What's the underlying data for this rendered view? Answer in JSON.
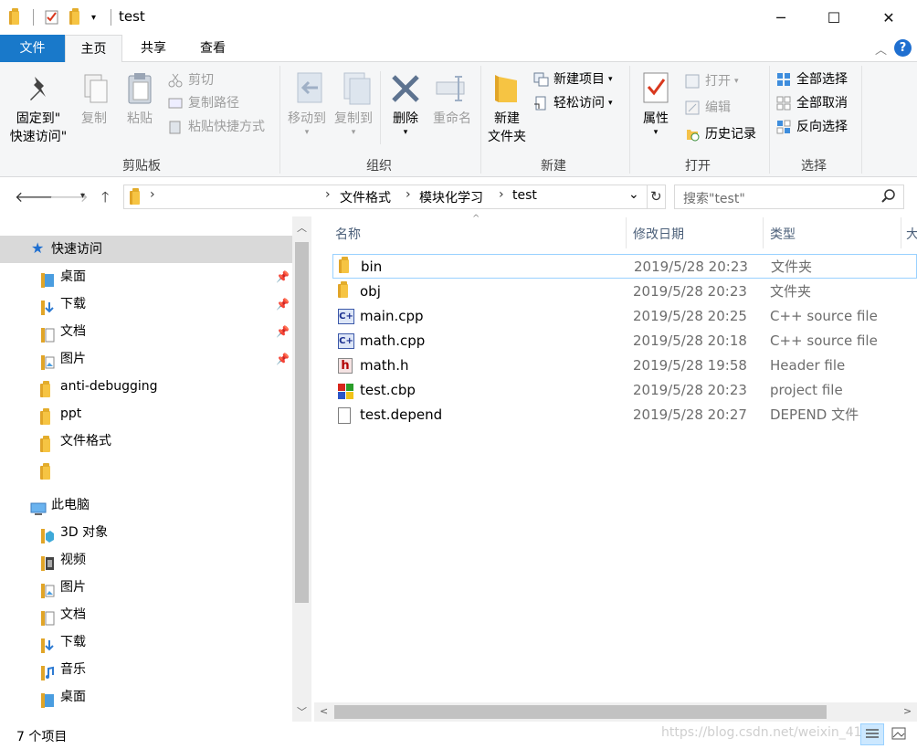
{
  "window": {
    "title": "test",
    "minimize": "─",
    "maximize": "☐",
    "close": "✕"
  },
  "ribbon_tabs": {
    "file": "文件",
    "home": "主页",
    "share": "共享",
    "view": "查看"
  },
  "ribbon": {
    "clipboard": {
      "label": "剪贴板",
      "pin_line1": "固定到\"",
      "pin_line2": "快速访问\"",
      "copy": "复制",
      "paste": "粘贴",
      "cut": "剪切",
      "copy_path": "复制路径",
      "paste_shortcut": "粘贴快捷方式"
    },
    "organize": {
      "label": "组织",
      "move_to": "移动到",
      "copy_to": "复制到",
      "delete": "删除",
      "rename": "重命名"
    },
    "new": {
      "label": "新建",
      "new_folder_line1": "新建",
      "new_folder_line2": "文件夹",
      "new_item": "新建项目",
      "easy_access": "轻松访问"
    },
    "open": {
      "label": "打开",
      "properties": "属性",
      "open": "打开",
      "edit": "编辑",
      "history": "历史记录"
    },
    "select": {
      "label": "选择",
      "select_all": "全部选择",
      "select_none": "全部取消",
      "invert": "反向选择"
    }
  },
  "address": {
    "breadcrumbs": [
      "文件格式",
      "模块化学习",
      "test"
    ],
    "search_placeholder": "搜索\"test\""
  },
  "nav_pane": {
    "quick_access": "快速访问",
    "quick_items": [
      "桌面",
      "下载",
      "文档",
      "图片",
      "anti-debugging",
      "ppt",
      "文件格式"
    ],
    "this_pc": "此电脑",
    "pc_items": [
      "3D 对象",
      "视频",
      "图片",
      "文档",
      "下载",
      "音乐",
      "桌面"
    ]
  },
  "columns": {
    "name": "名称",
    "date": "修改日期",
    "type": "类型",
    "size": "大"
  },
  "files": [
    {
      "name": "bin",
      "date": "2019/5/28 20:23",
      "type": "文件夹",
      "icon": "folder-icon"
    },
    {
      "name": "obj",
      "date": "2019/5/28 20:23",
      "type": "文件夹",
      "icon": "folder-icon"
    },
    {
      "name": "main.cpp",
      "date": "2019/5/28 20:25",
      "type": "C++ source file",
      "icon": "cpp-file-icon"
    },
    {
      "name": "math.cpp",
      "date": "2019/5/28 20:18",
      "type": "C++ source file",
      "icon": "cpp-file-icon"
    },
    {
      "name": "math.h",
      "date": "2019/5/28 19:58",
      "type": "Header file",
      "icon": "header-file-icon"
    },
    {
      "name": "test.cbp",
      "date": "2019/5/28 20:23",
      "type": "project file",
      "icon": "project-file-icon"
    },
    {
      "name": "test.depend",
      "date": "2019/5/28 20:27",
      "type": "DEPEND 文件",
      "icon": "generic-file-icon"
    }
  ],
  "status": {
    "item_count": "7 个项目",
    "watermark": "https://blog.csdn.net/weixin_41"
  },
  "colors": {
    "file_tab": "#1979ca",
    "folder": "#f4c24a",
    "selection": "#d9d9d9",
    "accent": "#1f6fd0"
  }
}
